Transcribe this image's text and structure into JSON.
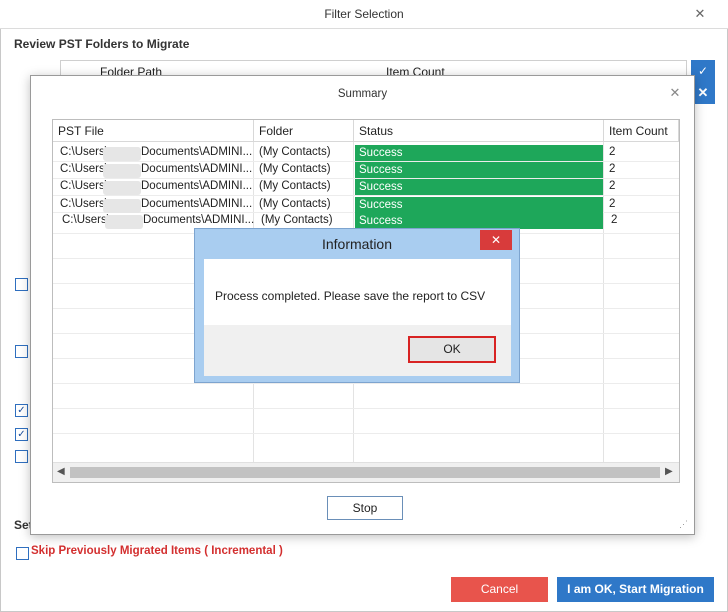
{
  "window": {
    "title": "Filter Selection",
    "close_glyph": "✕"
  },
  "review_title": "Review PST Folders to Migrate",
  "folder_table": {
    "headers": [
      "Folder Path",
      "Item Count"
    ]
  },
  "side_buttons": [
    "check-all-icon",
    "uncheck-all-icon"
  ],
  "settings_label": "Set",
  "skip_label": "Skip Previously Migrated Items ( Incremental )",
  "buttons": {
    "cancel": "Cancel",
    "start": "I am OK, Start Migration"
  },
  "summary": {
    "title": "Summary",
    "headers": [
      "PST File",
      "Folder",
      "Status",
      "Item Count"
    ],
    "rows": [
      {
        "pre": "C:\\Users\\",
        "post": "Documents\\ADMINI...",
        "folder": "(My Contacts)",
        "status": "Success",
        "count": "2"
      },
      {
        "pre": "C:\\Users\\",
        "post": "Documents\\ADMINI...",
        "folder": "(My Contacts)",
        "status": "Success",
        "count": "2"
      },
      {
        "pre": "C:\\Users\\",
        "post": "Documents\\ADMINI...",
        "folder": "(My Contacts)",
        "status": "Success",
        "count": "2"
      },
      {
        "pre": "C:\\Users\\",
        "post": "Documents\\ADMINI...",
        "folder": "(My Contacts)",
        "status": "Success",
        "count": "2"
      },
      {
        "pre": "C:\\Users\\",
        "post": "Documents\\ADMINI...",
        "folder": "(My Contacts)",
        "status": "Success",
        "count": "2"
      }
    ],
    "stop_label": "Stop"
  },
  "info_dialog": {
    "title": "Information",
    "message": "Process completed. Please save the report to CSV",
    "ok_label": "OK",
    "close_glyph": "✕"
  },
  "colors": {
    "accent": "#2f78c8",
    "success": "#1ea75a",
    "danger": "#e8544c"
  }
}
